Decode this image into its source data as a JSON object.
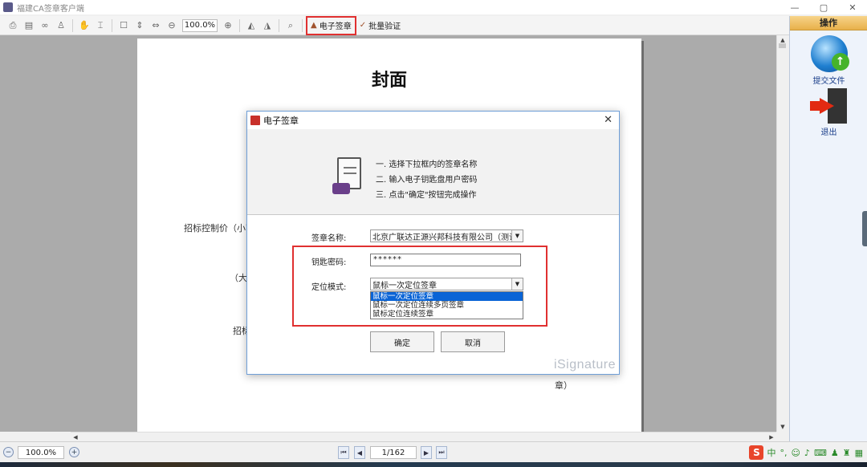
{
  "window": {
    "title": "福建CA签章客户端",
    "controls": [
      "—",
      "▢",
      "✕"
    ]
  },
  "toolbar": {
    "zoom_value": "100.0%",
    "sign_button_label": "电子签章",
    "verify_button_label": "批量验证"
  },
  "document": {
    "title": "封面",
    "lines": [
      "招标控制价（小写",
      "（大写",
      "招标",
      "章）"
    ]
  },
  "right_panel": {
    "header": "操作",
    "submit_label": "提交文件",
    "exit_label": "退出"
  },
  "status": {
    "zoom_value": "100.0%",
    "page_indicator": "1/162",
    "tray_lang": "中"
  },
  "dialog": {
    "title": "电子签章",
    "steps": [
      "一. 选择下拉框内的签章名称",
      "二. 输入电子钥匙盘用户密码",
      "三. 点击\"确定\"按钮完成操作"
    ],
    "seal_name_label": "签章名称:",
    "seal_name_value": "北京广联达正源兴邦科技有限公司（测试",
    "password_label": "钥匙密码:",
    "password_value": "******",
    "position_mode_label": "定位模式:",
    "position_mode_value": "鼠标一次定位签章",
    "position_mode_options": [
      "鼠标一次定位签章",
      "鼠标一次定位连续多页签章",
      "鼠标定位连续签章"
    ],
    "confirm_label": "确定",
    "cancel_label": "取消",
    "watermark": "iSignature"
  }
}
